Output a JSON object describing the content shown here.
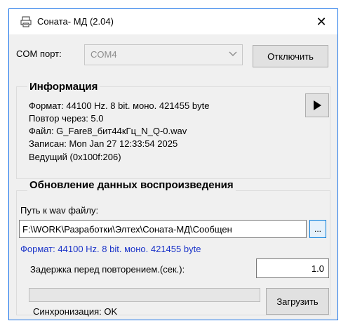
{
  "window": {
    "title": "Соната- МД (2.04)",
    "close_glyph": "✕",
    "app_icon": "app-printer-icon"
  },
  "com": {
    "label": "COM порт:",
    "value": "COM4",
    "disconnect_button": "Отключить"
  },
  "info": {
    "title": "Информация",
    "format": "Формат: 44100 Hz. 8 bit. моно. 421455 byte",
    "repeat": "Повтор через:  5.0",
    "file": "Файл: G_Fare8_бит44кГц_N_Q-0.wav",
    "recorded": "Записан: Mon Jan 27 12:33:54 2025",
    "master": "Ведущий (0x100f:206)",
    "play_icon": "play-icon"
  },
  "update": {
    "title": "Обновление данных воспроизведения",
    "path_label": "Путь к wav файлу:",
    "path_value": "F:\\WORK\\Разработки\\Элтех\\Соната-МД\\Сообщен",
    "browse_button": "...",
    "format_blue": "Формат: 44100 Hz. 8 bit. моно. 421455 byte",
    "delay_label": "Задержка перед повторением.(сек.):",
    "delay_value": "1.0",
    "progress": 0,
    "load_button": "Загрузить",
    "sync_status": "Синхронизация: OK"
  },
  "colors": {
    "accent": "#1a73e8",
    "link_blue": "#1a33c8",
    "window_bg": "#f0f0f0"
  }
}
